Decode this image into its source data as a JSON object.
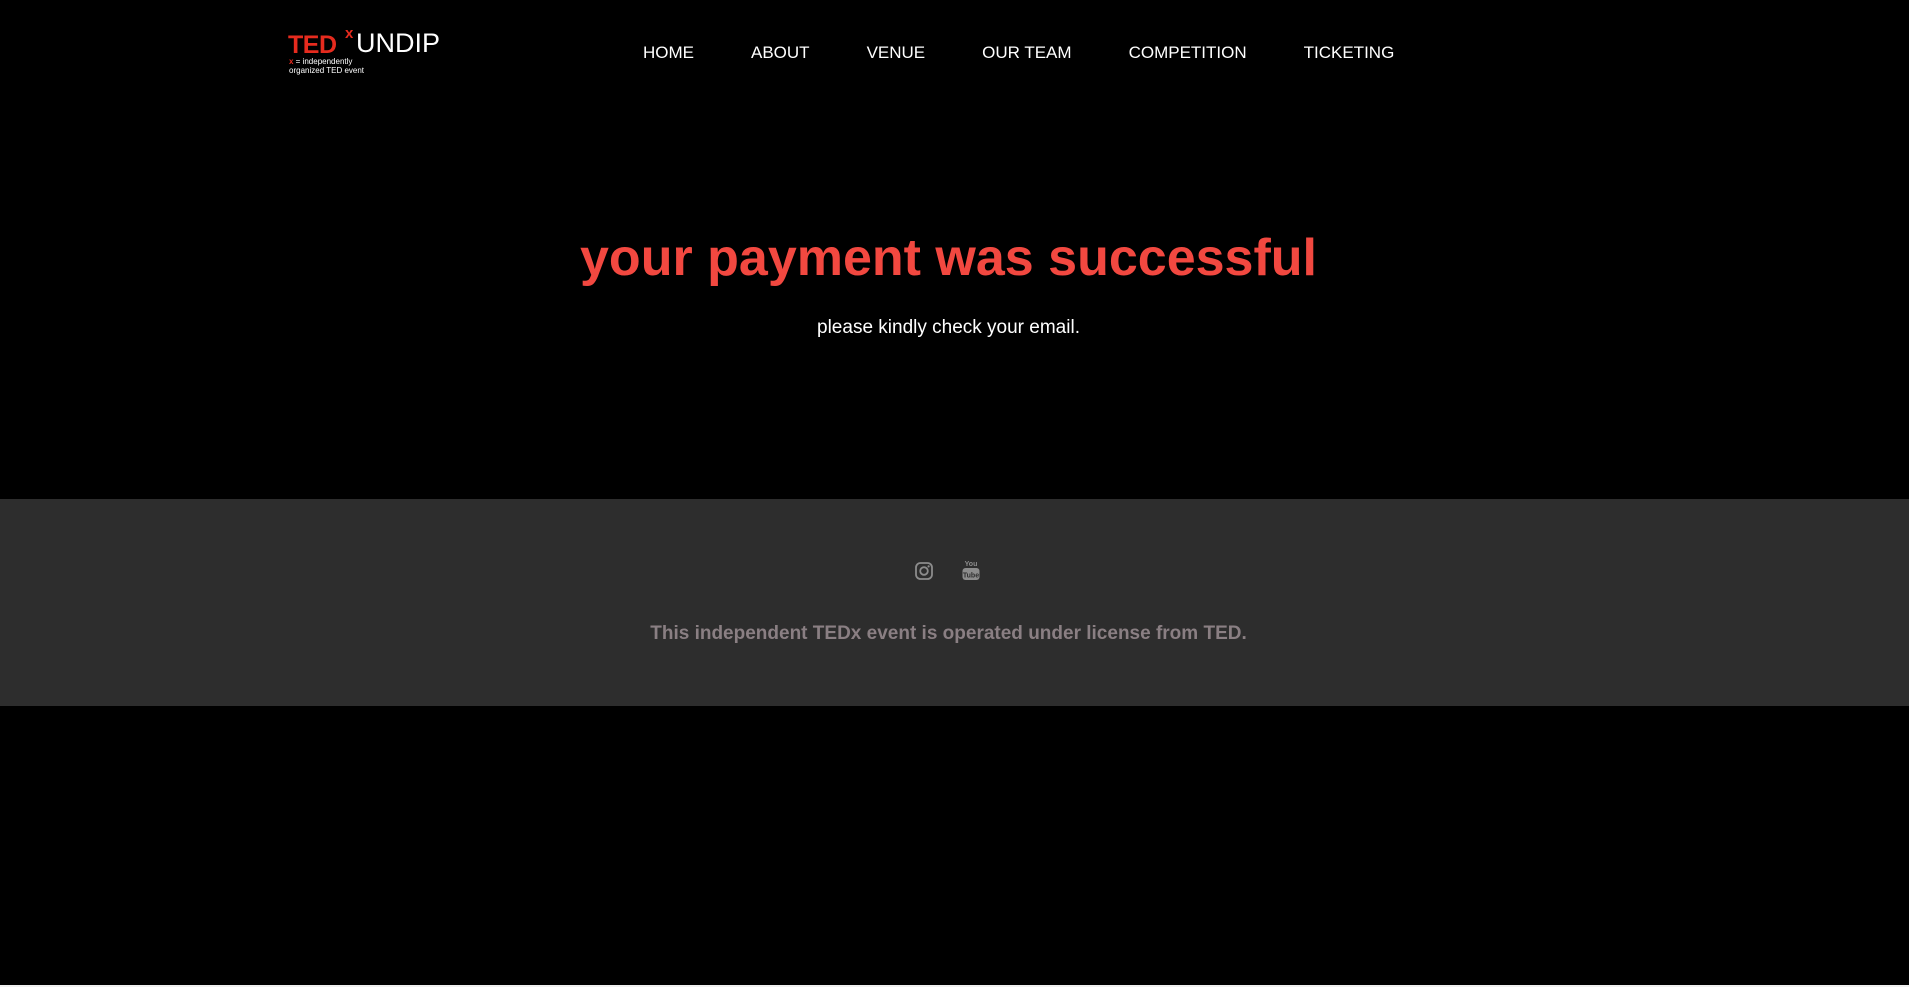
{
  "header": {
    "logo": {
      "ted": "TED",
      "x": "x",
      "name": "UNDIP",
      "tagline_x": "x",
      "tagline_line1": " = independently",
      "tagline_line2": "organized TED event"
    },
    "nav": [
      {
        "label": "HOME"
      },
      {
        "label": "ABOUT"
      },
      {
        "label": "VENUE"
      },
      {
        "label": "OUR TEAM"
      },
      {
        "label": "COMPETITION"
      },
      {
        "label": "TICKETING"
      }
    ]
  },
  "hero": {
    "title": "your payment was successful",
    "subtitle": "please kindly check your email."
  },
  "footer": {
    "social": [
      {
        "icon": "instagram-icon"
      },
      {
        "icon": "youtube-icon"
      }
    ],
    "license_text": "This independent TEDx event is operated under license from TED."
  },
  "colors": {
    "background": "#000000",
    "accent_red": "#f24840",
    "logo_red": "#e62b1e",
    "footer_bg": "#2d2d2d",
    "footer_text": "#8a7f83",
    "icon_gray": "#8c8c8c"
  }
}
